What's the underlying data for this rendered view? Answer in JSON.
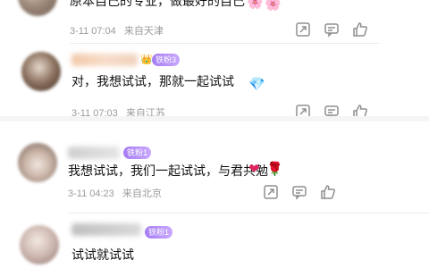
{
  "comments": [
    {
      "text": "原本自己的专业，做最好的自己",
      "time": "3-11 07:04",
      "location": "来自天津"
    },
    {
      "badge": "铁粉3",
      "text": "对，我想试试，那就一起试试",
      "time": "3-11 07:03",
      "location": "来自江苏"
    },
    {
      "badge": "铁粉1",
      "text": "我想试试，我们一起试试，与君共勉",
      "time": "3-11 04:23",
      "location": "来自北京"
    },
    {
      "badge": "铁粉1",
      "text": "试试就试试"
    }
  ],
  "icons": {
    "share": "share-icon",
    "reply": "comment-icon",
    "like": "like-icon",
    "heart": "heart-emoji",
    "rose": "rose-emoji",
    "gem": "gem-emoji"
  }
}
